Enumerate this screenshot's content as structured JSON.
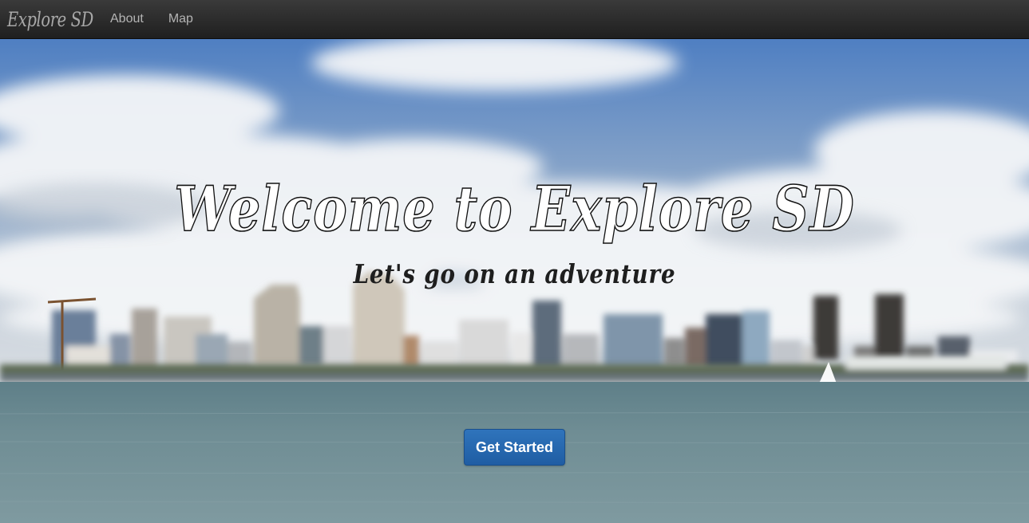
{
  "navbar": {
    "brand": "Explore SD",
    "links": [
      {
        "label": "About"
      },
      {
        "label": "Map"
      }
    ]
  },
  "hero": {
    "title": "Welcome to Explore SD",
    "subtitle": "Let's go on an adventure",
    "cta_label": "Get Started"
  },
  "colors": {
    "navbar": "#2b2b2b",
    "sky": "#5a8bc8",
    "water": "#6d8a90",
    "cta": "#276ab3"
  },
  "icons": {
    "background": "city-skyline-photo"
  }
}
